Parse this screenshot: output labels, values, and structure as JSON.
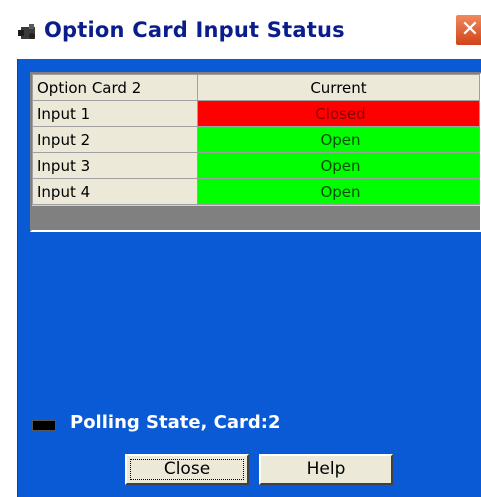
{
  "window": {
    "title": "Option Card Input Status",
    "close_glyph": "✕"
  },
  "grid": {
    "headers": [
      "Option Card 2",
      "Current"
    ],
    "rows": [
      {
        "name": "Input 1",
        "value": "Closed",
        "status": "closed"
      },
      {
        "name": "Input 2",
        "value": "Open",
        "status": "open"
      },
      {
        "name": "Input 3",
        "value": "Open",
        "status": "open"
      },
      {
        "name": "Input 4",
        "value": "Open",
        "status": "open"
      }
    ]
  },
  "status": {
    "polling_text": "Polling State, Card:2"
  },
  "buttons": {
    "close_label": "Close",
    "help_label": "Help"
  },
  "colors": {
    "client_bg": "#0a5ad6",
    "title_text": "#0a1d8c",
    "closed": "#ff0000",
    "open": "#00ff00"
  },
  "icons": {
    "title_icon": "app-icon",
    "polling_indicator": "status-led"
  }
}
